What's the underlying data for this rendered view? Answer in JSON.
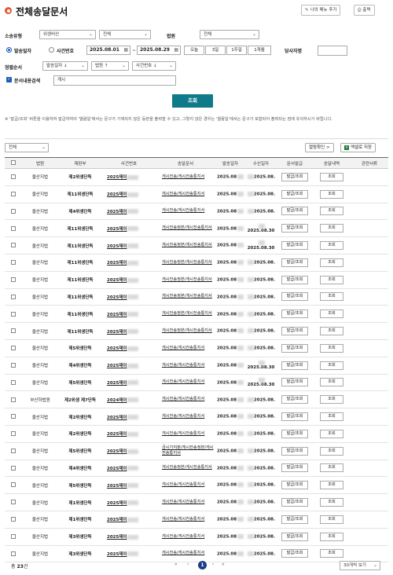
{
  "header": {
    "title": "전체송달문서",
    "menu_add_label": "나의 메뉴 추가",
    "print_label": "출력"
  },
  "form": {
    "case_type_label": "소송유형",
    "case_type_value": "위생비산",
    "case_sub_value": "전체",
    "court_label": "법원",
    "court_value": "전체",
    "radio_send_date": "발송일자",
    "radio_case_no": "사건번호",
    "date_from": "2025.08.01",
    "date_to": "2025.08.29",
    "period_buttons": [
      "오늘",
      "3일",
      "1주일",
      "1개월"
    ],
    "party_label": "당사자명",
    "sort_label": "정렬순서",
    "sort_options": [
      "발송일자 ↓",
      "법원 ↑",
      "사건번호 ↓"
    ],
    "checkbox_label": "문서내용검색",
    "keyword_value": "게시",
    "search_button": "조회"
  },
  "notice": "※ '발급/조회' 버튼을 이용하여 발급하여야 '열람일'에서는 문구가 기재되지 않은 등본을 출력할 수 있고, 그렇지 않은 경우는 '열람일'에서는 문구가 포함되어 출력되는 점에 유의하시기 바랍니다.",
  "toolbar": {
    "filter_value": "전체",
    "confirm_label": "열람확인 >",
    "excel_label": "엑셀로 저장"
  },
  "table": {
    "headers": [
      "",
      "법원",
      "재판부",
      "사건번호",
      "송달문서",
      "발송일자",
      "수신일자",
      "문서발급",
      "송달내역",
      "관련서류"
    ],
    "rows": [
      {
        "court": "울산지법",
        "dept": "제2위생단독",
        "case": "2025재이",
        "doc": "게시전송/게시전송통지서",
        "sent": "2025.08",
        "recv": "2025.08.",
        "issue": "발급/조회",
        "history": "조회"
      },
      {
        "court": "울산지법",
        "dept": "제11위생단독",
        "case": "2025재이",
        "doc": "게시전송/게시전송통지서",
        "sent": "2025.08",
        "recv": "2025.08.",
        "issue": "발급/조회",
        "history": "조회"
      },
      {
        "court": "울산지법",
        "dept": "제4위생단독",
        "case": "2025재이",
        "doc": "게시전송/게시전송통지서",
        "sent": "2025.08",
        "recv": "2025.08.",
        "issue": "발급/조회",
        "history": "조회"
      },
      {
        "court": "울산지법",
        "dept": "제11위생단독",
        "case": "2025재이",
        "doc": "게시전송정본/게시전송통지서",
        "sent": "2025.08",
        "recv": "2025.08.30",
        "issue": "발급/조회",
        "history": "조회"
      },
      {
        "court": "울산지법",
        "dept": "제11위생단독",
        "case": "2025재이",
        "doc": "게시전송정본/게시전송통지서",
        "sent": "2025.08",
        "recv": "2025.08.30",
        "issue": "발급/조회",
        "history": "조회"
      },
      {
        "court": "울산지법",
        "dept": "제11위생단독",
        "case": "2025재이",
        "doc": "게시전송정본/게시전송통지서",
        "sent": "2025.08",
        "recv": "2025.08.",
        "issue": "발급/조회",
        "history": "조회"
      },
      {
        "court": "울산지법",
        "dept": "제11위생단독",
        "case": "2025재이",
        "doc": "게시전송정본/게시전송통지서",
        "sent": "2025.08",
        "recv": "2025.08.",
        "issue": "발급/조회",
        "history": "조회"
      },
      {
        "court": "울산지법",
        "dept": "제11위생단독",
        "case": "2025재이",
        "doc": "게시전송정본/게시전송통지서",
        "sent": "2025.08",
        "recv": "2025.08.",
        "issue": "발급/조회",
        "history": "조회"
      },
      {
        "court": "울산지법",
        "dept": "제11위생단독",
        "case": "2025재이",
        "doc": "게시전송정본/게시전송통지서",
        "sent": "2025.08",
        "recv": "2025.08.",
        "issue": "발급/조회",
        "history": "조회"
      },
      {
        "court": "울산지법",
        "dept": "제11위생단독",
        "case": "2025재이",
        "doc": "게시전송정본/게시전송통지서",
        "sent": "2025.08",
        "recv": "2025.08.",
        "issue": "발급/조회",
        "history": "조회"
      },
      {
        "court": "울산지법",
        "dept": "제5위생단독",
        "case": "2025재이",
        "doc": "게시전송/게시전송통지서",
        "sent": "2025.08",
        "recv": "2025.08.",
        "issue": "발급/조회",
        "history": "조회"
      },
      {
        "court": "울산지법",
        "dept": "제4위생단독",
        "case": "2025재이",
        "doc": "게시전송/게시전송통지서",
        "sent": "2025.08",
        "recv": "2025.08.30",
        "issue": "발급/조회",
        "history": "조회"
      },
      {
        "court": "울산지법",
        "dept": "제5위생단독",
        "case": "2025재이",
        "doc": "게시전송/게시전송통지서",
        "sent": "2025.08",
        "recv": "2025.08.30",
        "issue": "발급/조회",
        "history": "조회"
      },
      {
        "court": "부산하법원",
        "dept": "제2위생 제7단독",
        "case": "2024재이",
        "doc": "게시전송/게시전송통지서",
        "sent": "2025.08",
        "recv": "2025.08.",
        "issue": "발급/조회",
        "history": "조회"
      },
      {
        "court": "울산지법",
        "dept": "제2위생단독",
        "case": "2025재이",
        "doc": "게시전송/게시전송통지서",
        "sent": "2025.08",
        "recv": "2025.08.",
        "issue": "발급/조회",
        "history": "조회"
      },
      {
        "court": "울산지법",
        "dept": "제2위생단독",
        "case": "2025재이",
        "doc": "게시전송/게시전송통지서",
        "sent": "2025.08",
        "recv": "2025.08.",
        "issue": "발급/조회",
        "history": "조회"
      },
      {
        "court": "울산지법",
        "dept": "제5위생단독",
        "case": "2025재이",
        "doc": "금시가처분/게시전송정본/게시전송통지서",
        "sent": "2025.08",
        "recv": "2025.08.",
        "issue": "발급/조회",
        "history": "조회"
      },
      {
        "court": "울산지법",
        "dept": "제4위생단독",
        "case": "2025재이",
        "doc": "게시전송정본/게시전송통지서",
        "sent": "2025.08",
        "recv": "2025.08.",
        "issue": "발급/조회",
        "history": "조회"
      },
      {
        "court": "울산지법",
        "dept": "제5위생단독",
        "case": "2025재이",
        "doc": "게시전송/게시전송통지서",
        "sent": "2025.08",
        "recv": "2025.08.",
        "issue": "발급/조회",
        "history": "조회"
      },
      {
        "court": "울산지법",
        "dept": "제1위생단독",
        "case": "2025재이",
        "doc": "게시전송/게시전송통지서",
        "sent": "2025.08",
        "recv": "2025.08.",
        "issue": "발급/조회",
        "history": "조회"
      },
      {
        "court": "울산지법",
        "dept": "제1위생단독",
        "case": "2025재이",
        "doc": "게시전송/게시전송통지서",
        "sent": "2025.08",
        "recv": "2025.08.",
        "issue": "발급/조회",
        "history": "조회"
      },
      {
        "court": "울산지법",
        "dept": "제3위생단독",
        "case": "2025재이",
        "doc": "게시전송/게시전송통지서",
        "sent": "2025.08",
        "recv": "2025.08.",
        "issue": "발급/조회",
        "history": "조회"
      },
      {
        "court": "울산지법",
        "dept": "제3위생단독",
        "case": "2025재이",
        "doc": "게시전송/게시전송통지서",
        "sent": "2025.08",
        "recv": "2025.08.",
        "issue": "발급/조회",
        "history": "조회"
      }
    ]
  },
  "footer": {
    "total_prefix": "총",
    "total_count": "23",
    "total_suffix": "건",
    "current_page": "1",
    "per_page": "30개씩 보기"
  }
}
